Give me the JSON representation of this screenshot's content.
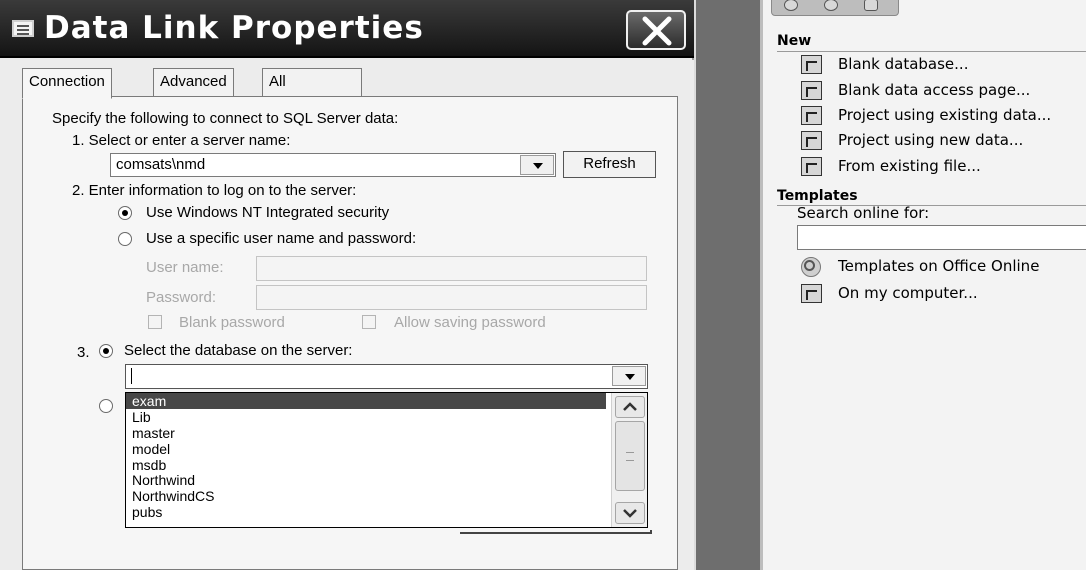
{
  "dialog": {
    "title": "Data Link Properties",
    "tabs": [
      "Connection",
      "Advanced",
      "All"
    ],
    "intro": "Specify the following to connect to SQL Server data:",
    "step1": {
      "label": "1. Select or enter a server name:",
      "server_value": "comsats\\nmd",
      "refresh_label": "Refresh"
    },
    "step2": {
      "label": "2. Enter information to log on to the server:",
      "option_nt": "Use Windows NT Integrated security",
      "option_specific": "Use a specific user name and password:",
      "username_label": "User name:",
      "password_label": "Password:",
      "blank_password": "Blank password",
      "allow_saving": "Allow saving password"
    },
    "step3": {
      "number": "3.",
      "option_select_db": "Select the database on the server:",
      "db_value": "",
      "db_list": [
        "exam",
        "Lib",
        "master",
        "model",
        "msdb",
        "Northwind",
        "NorthwindCS",
        "pubs"
      ],
      "selected_db": "exam"
    }
  },
  "task_pane": {
    "new_heading": "New",
    "new_items": [
      "Blank database...",
      "Blank data access page...",
      "Project using existing data...",
      "Project using new data...",
      "From existing file..."
    ],
    "templates_heading": "Templates",
    "search_label": "Search online for:",
    "template_items": [
      "Templates on Office Online",
      "On my computer..."
    ]
  },
  "icons": {
    "title": "window-menu-icon",
    "close": "close-icon",
    "new_items": [
      "database-icon",
      "page-icon",
      "project-icon",
      "project-new-icon",
      "file-icon"
    ],
    "templates": [
      "globe-icon",
      "computer-icon"
    ]
  }
}
